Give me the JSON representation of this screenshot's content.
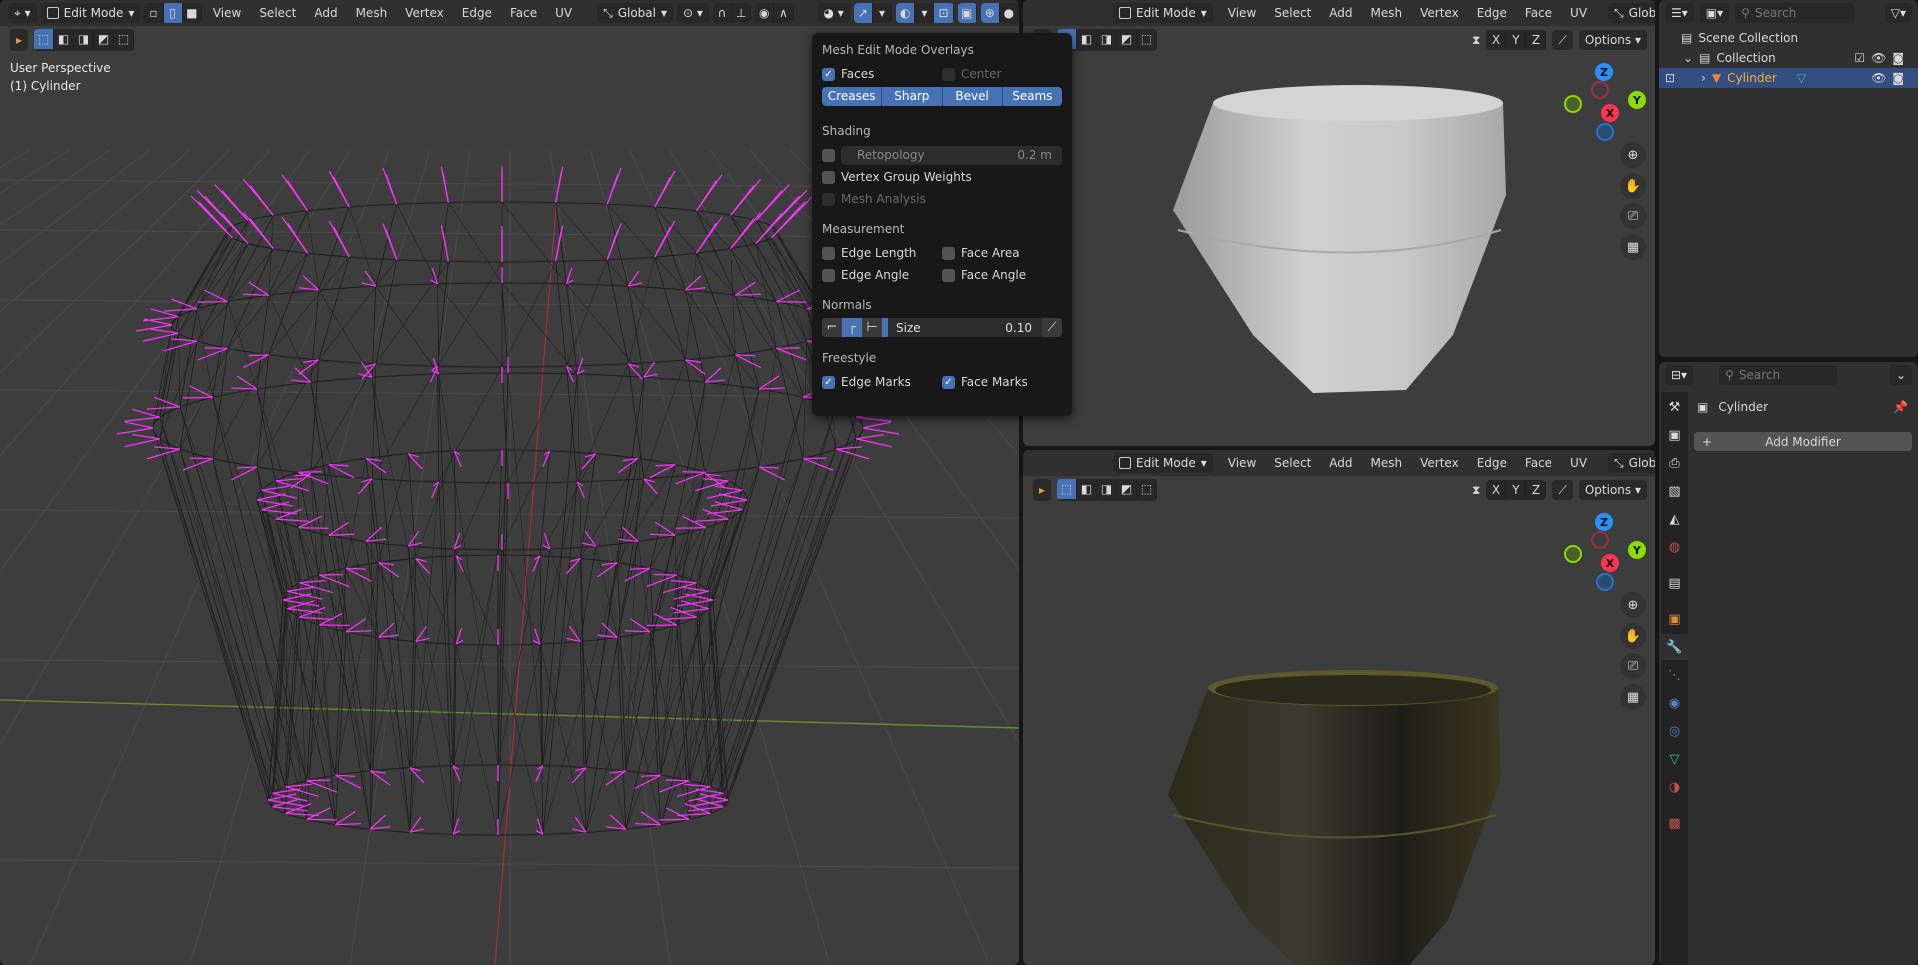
{
  "left_viewport": {
    "mode": "Edit Mode",
    "menus": [
      "View",
      "Select",
      "Add",
      "Mesh",
      "Vertex",
      "Edge",
      "Face",
      "UV"
    ],
    "orientation": "Global",
    "view_label": "User Perspective",
    "object_label": "(1) Cylinder"
  },
  "overlay_popup": {
    "title": "Mesh Edit Mode Overlays",
    "faces": {
      "label": "Faces",
      "checked": true
    },
    "center": {
      "label": "Center",
      "checked": false
    },
    "edge_buttons": [
      "Creases",
      "Sharp",
      "Bevel",
      "Seams"
    ],
    "shading_title": "Shading",
    "retopology": {
      "label": "Retopology",
      "value": "0.2 m"
    },
    "vertex_group_weights": "Vertex Group Weights",
    "mesh_analysis": "Mesh Analysis",
    "measurement_title": "Measurement",
    "edge_length": "Edge Length",
    "face_area": "Face Area",
    "edge_angle": "Edge Angle",
    "face_angle": "Face Angle",
    "normals_title": "Normals",
    "size": {
      "label": "Size",
      "value": "0.10"
    },
    "freestyle_title": "Freestyle",
    "edge_marks": {
      "label": "Edge Marks",
      "checked": true
    },
    "face_marks": {
      "label": "Face Marks",
      "checked": true
    }
  },
  "right_viewport": {
    "mode": "Edit Mode",
    "menus": [
      "View",
      "Select",
      "Add",
      "Mesh",
      "Vertex",
      "Edge",
      "Face",
      "UV"
    ],
    "orientation": "Global",
    "axes": [
      "X",
      "Y",
      "Z"
    ],
    "options": "Options",
    "gizmo": {
      "x": "X",
      "y": "Y",
      "z": "Z"
    }
  },
  "outliner": {
    "search_placeholder": "Search",
    "items": [
      {
        "label": "Scene Collection"
      },
      {
        "label": "Collection"
      },
      {
        "label": "Cylinder",
        "selected": true
      }
    ]
  },
  "properties": {
    "search_placeholder": "Search",
    "object_name": "Cylinder",
    "add_modifier": "Add Modifier",
    "active_tab": "modifiers"
  },
  "colors": {
    "accent": "#4772b3",
    "normals": "#ff33ff",
    "x_axis": "#ff3352",
    "y_axis": "#8bdc00",
    "z_axis": "#2c8fff",
    "selected_object": "#ffaf29"
  }
}
